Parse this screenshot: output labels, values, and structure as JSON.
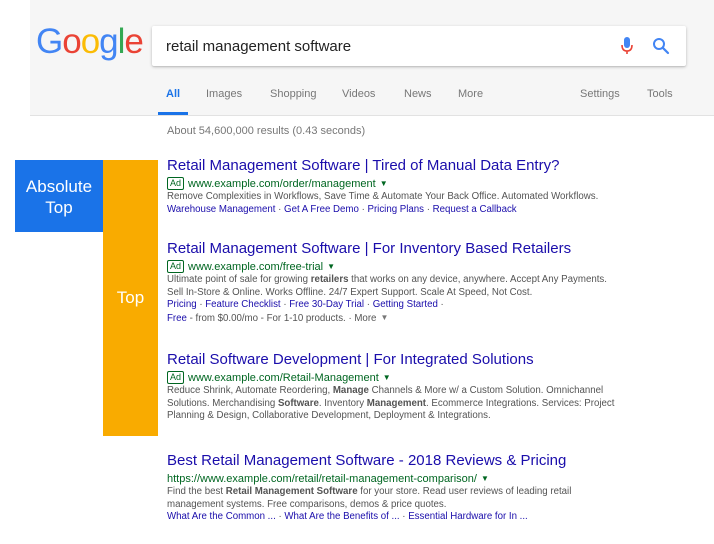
{
  "header": {
    "logo": {
      "letters": [
        "G",
        "o",
        "o",
        "g",
        "l",
        "e"
      ],
      "colors": [
        "#4285f4",
        "#ea4335",
        "#fbbc05",
        "#4285f4",
        "#34a853",
        "#ea4335"
      ]
    },
    "search": {
      "query": "retail management software"
    },
    "tabs": [
      {
        "label": "All",
        "active": true
      },
      {
        "label": "Images"
      },
      {
        "label": "Shopping"
      },
      {
        "label": "Videos"
      },
      {
        "label": "News"
      },
      {
        "label": "More"
      },
      {
        "label": "Settings"
      },
      {
        "label": "Tools"
      }
    ]
  },
  "result_stats": "About 54,600,000 results (0.43 seconds)",
  "labels": {
    "absolute_top": [
      "Absolute",
      "Top"
    ],
    "top": "Top"
  },
  "results": [
    {
      "title": "Retail Management Software | Tired of Manual Data Entry?",
      "ad": "Ad",
      "url": "www.example.com/order/management",
      "desc": [
        "Remove Complexities in Workflows, Save Time & Automate Your Back Office. Automated Workflows."
      ],
      "sitelinks": [
        "Warehouse Management",
        "Get A Free Demo",
        "Pricing Plans",
        "Request a Callback"
      ]
    },
    {
      "title": "Retail Management Software | For Inventory Based Retailers",
      "ad": "Ad",
      "url": "www.example.com/free-trial",
      "desc_line1_before": "Ultimate point of sale for growing ",
      "desc_line1_bold": "retailers",
      "desc_line1_after": " that works on any device, anywhere. Accept Any Payments.",
      "desc_line2": "Sell In-Store & Online. Works Offline. 24/7 Expert Support. Scale At Speed, Not Cost.",
      "sitelinks": [
        "Pricing",
        "Feature Checklist",
        "Free 30-Day Trial",
        "Getting Started"
      ],
      "extra": {
        "link": "Free",
        "text": " - from $0.00/mo - For 1-10 products. · More"
      }
    },
    {
      "title": "Retail Software Development | For Integrated Solutions",
      "ad": "Ad",
      "url": "www.example.com/Retail-Management",
      "desc_l1a": "Reduce Shrink, Automate Reordering, ",
      "desc_l1b": "Manage",
      "desc_l1c": " Channels & More w/ a Custom Solution. Omnichannel",
      "desc_l2a": "Solutions. Merchandising ",
      "desc_l2b": "Software",
      "desc_l2c": ". Inventory ",
      "desc_l2d": "Management",
      "desc_l2e": ". Ecommerce Integrations. Services: Project",
      "desc_l3": "Planning & Design, Collaborative Development, Deployment & Integrations."
    },
    {
      "title": "Best Retail Management Software - 2018 Reviews & Pricing",
      "url": "https://www.example.com/retail/retail-management-comparison/",
      "desc_l1a": "Find the best ",
      "desc_l1b": "Retail Management Software",
      "desc_l1c": " for your store. Read user reviews of leading retail",
      "desc_l2": "management systems. Free comparisons, demos & price quotes.",
      "sitelinks": [
        "What Are the Common ...",
        "What Are the Benefits of ...",
        "Essential Hardware for In ..."
      ]
    }
  ]
}
